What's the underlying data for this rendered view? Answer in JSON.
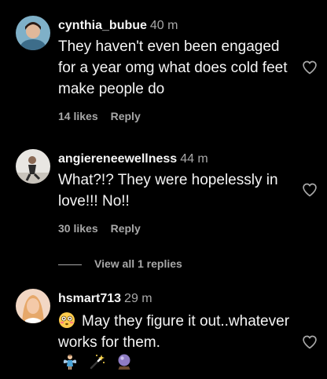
{
  "comments": [
    {
      "username": "cynthia_bubue",
      "time": "40 m",
      "text": "They haven't even been engaged for a year omg what does cold feet make people do",
      "likes": "14 likes",
      "reply_label": "Reply"
    },
    {
      "username": "angiereneewellness",
      "time": "44 m",
      "text": "What?!? They were hopelessly in love!!! No!!",
      "likes": "30 likes",
      "reply_label": "Reply",
      "view_replies": "View all 1 replies"
    },
    {
      "username": "hsmart713",
      "time": "29 m",
      "text": "May they figure it out..whatever works for them.",
      "emoji_leading": "flushed-face",
      "emoji_trailing": [
        "fairy",
        "magic-wand",
        "crystal-ball"
      ]
    }
  ],
  "colors": {
    "background": "#000000",
    "text": "#f5f5f5",
    "secondary": "#a8a8a8"
  }
}
